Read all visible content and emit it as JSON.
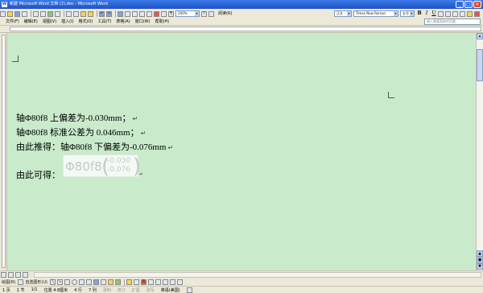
{
  "window": {
    "title": "新建 Microsoft Word 文档 (2).doc - Microsoft Word"
  },
  "menu": [
    "文件(F)",
    "编辑(E)",
    "视图(V)",
    "插入(I)",
    "格式(O)",
    "工具(T)",
    "表格(A)",
    "窗口(W)",
    "帮助(H)"
  ],
  "toolbar": {
    "zoom": "200%",
    "read_label": "阅读(R)"
  },
  "format_toolbar": {
    "style": "正文",
    "font": "Times New Roman",
    "size": "五号",
    "bold": "B",
    "italic": "I",
    "underline": "U"
  },
  "help_box": {
    "placeholder": "键入需要帮助的问题"
  },
  "document": {
    "line1": "轴Φ80f8 上偏差为-0.030mm；",
    "line2": "轴Φ80f8 标准公差为 0.046mm；",
    "line3": "由此推得：轴Φ80f8 下偏差为-0.076mm",
    "line4": "由此可得：",
    "formula": {
      "base": "Φ80f8",
      "upper": "-0.030",
      "lower": "-0.076"
    }
  },
  "draw_toolbar": {
    "draw_label": "绘图(R)",
    "autoshape_label": "自选图形(U)"
  },
  "status": {
    "page": "1 页",
    "section": "1 节",
    "pages": "1/1",
    "position": "位置 4.8厘米",
    "line": "4 行",
    "column": "7 列",
    "rec": "录制",
    "trk": "修订",
    "ext": "扩展",
    "ovr": "改写",
    "language": "英语(美国)"
  }
}
